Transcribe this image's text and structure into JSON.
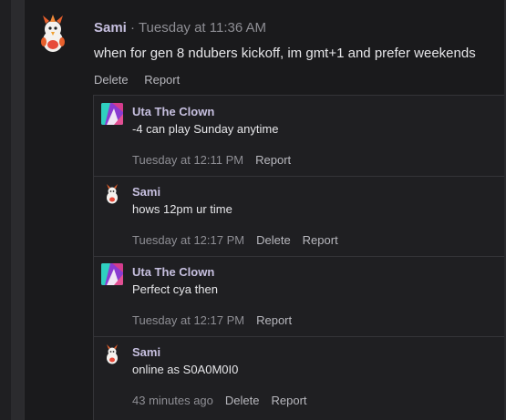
{
  "post": {
    "author": "Sami",
    "separator": "·",
    "timestamp": "Tuesday at 11:36 AM",
    "text": "when for gen 8 ndubers kickoff, im gmt+1 and prefer weekends",
    "actions": {
      "delete": "Delete",
      "report": "Report"
    }
  },
  "replies": [
    {
      "author": "Uta The Clown",
      "text": "-4 can play Sunday anytime",
      "time": "Tuesday at 12:11 PM",
      "report": "Report"
    },
    {
      "author": "Sami",
      "text": "hows 12pm ur time",
      "time": "Tuesday at 12:17 PM",
      "delete": "Delete",
      "report": "Report"
    },
    {
      "author": "Uta The Clown",
      "text": "Perfect cya then",
      "time": "Tuesday at 12:17 PM",
      "report": "Report"
    },
    {
      "author": "Sami",
      "text": "online as S0A0M0I0",
      "time": "43 minutes ago",
      "delete": "Delete",
      "report": "Report"
    }
  ]
}
